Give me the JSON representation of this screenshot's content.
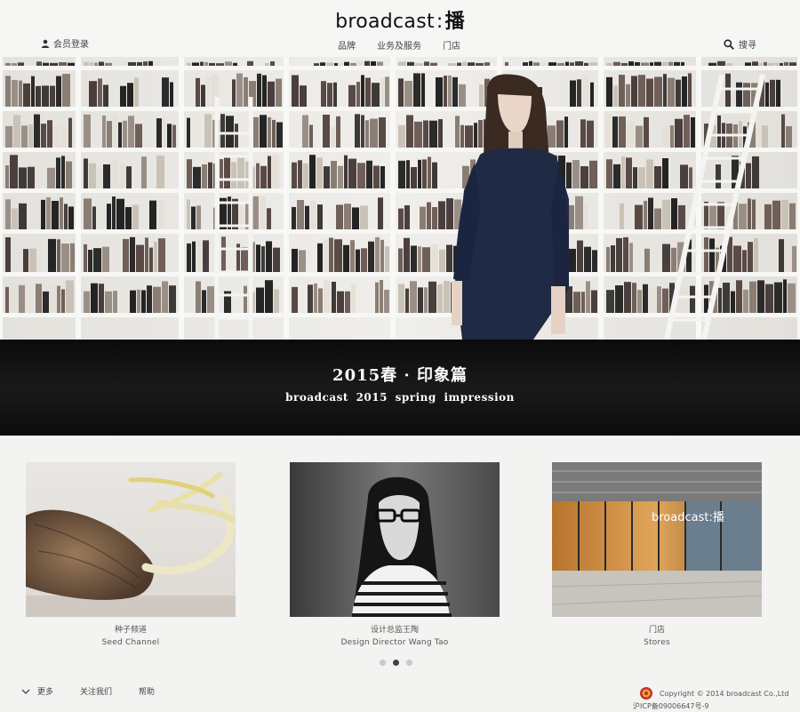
{
  "header": {
    "logo_en": "broadcast",
    "logo_sep": ":",
    "logo_cn": "播",
    "login_label": "会员登录",
    "nav": [
      "品牌",
      "业务及服务",
      "门店"
    ],
    "search_label": "搜寻"
  },
  "hero": {
    "slides": 4,
    "active_slide": 2
  },
  "banner": {
    "title": "2015春 · 印象篇",
    "subtitle": "broadcast 2015 spring impression"
  },
  "cards": [
    {
      "title_cn": "种子频道",
      "title_en": "Seed Channel",
      "image": "sprouting-onion"
    },
    {
      "title_cn": "设计总监王陶",
      "title_en": "Design Director Wang Tao",
      "image": "designer-portrait"
    },
    {
      "title_cn": "门店",
      "title_en": "Stores",
      "image": "storefront",
      "sign": "broadcast:播"
    }
  ],
  "pager": {
    "count": 3,
    "active": 1
  },
  "footer": {
    "more_label": "更多",
    "follow_label": "关注我们",
    "help_label": "帮助",
    "copyright": "Copyright © 2014 broadcast Co.,Ltd",
    "icp": "沪ICP备09006647号-9"
  },
  "colors": {
    "banner_bg": "#0d0d0d",
    "page_bg": "#f3f3f1",
    "dress": "#1f2a44"
  }
}
